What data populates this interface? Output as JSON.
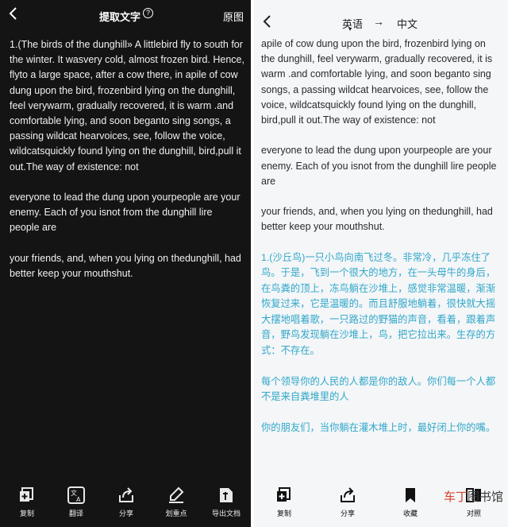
{
  "left": {
    "title": "提取文字",
    "help_icon": "?",
    "original_button": "原图",
    "paragraphs": [
      "1.(The birds of the dunghill» A littlebird fly to south for the winter. It wasvery cold, almost frozen bird. Hence, flyto a large space, after a cow there, in apile of cow dung upon the bird, frozenbird lying on the dunghill, feel verywarm, gradually recovered, it is warm .and comfortable lying, and soon beganto sing songs, a passing wildcat hearvoices, see, follow the voice, wildcatsquickly found lying on the dunghill, bird,pull it out.The way of existence: not",
      "everyone to lead the dung upon yourpeople are your enemy. Each of you isnot from the dunghill lire people are",
      "your friends, and, when you lying on thedunghill, had better keep your mouthshut."
    ],
    "toolbar": [
      {
        "label": "复制",
        "icon": "copy-icon"
      },
      {
        "label": "翻译",
        "icon": "translate-icon"
      },
      {
        "label": "分享",
        "icon": "share-icon"
      },
      {
        "label": "划重点",
        "icon": "highlight-icon"
      },
      {
        "label": "导出文档",
        "icon": "export-document-icon"
      }
    ]
  },
  "right": {
    "source_lang": "英语",
    "arrow": "→",
    "target_lang": "中文",
    "caret": "▾",
    "english_paragraphs": [
      "apile of cow dung upon the bird, frozenbird lying on the dunghill, feel verywarm, gradually recovered, it is warm .and comfortable lying, and soon beganto sing songs, a passing wildcat hearvoices, see, follow the voice, wildcatsquickly found lying on the dunghill, bird,pull it out.The way of existence: not",
      "everyone to lead the dung upon yourpeople are your enemy. Each of you isnot from the dunghill lire people are",
      "your friends, and, when you lying on thedunghill, had better keep your mouthshut."
    ],
    "chinese_paragraphs": [
      "1.(沙丘鸟)一只小鸟向南飞过冬。非常冷，几乎冻住了鸟。于是，飞到一个很大的地方，在一头母牛的身后，在鸟粪的顶上，冻鸟躺在沙堆上，感觉非常温暖，渐渐恢复过来，它是温暖的。而且舒服地躺着，很快就大摇大摆地唱着歌，一只路过的野猫的声音，看着，跟着声音，野鸟发现躺在沙堆上，鸟，把它拉出来。生存的方式：不存在。",
      "每个领导你的人民的人都是你的敌人。你们每一个人都不是来自粪堆里的人",
      "你的朋友们，当你躺在灌木堆上时，最好闭上你的嘴。"
    ],
    "toolbar": [
      {
        "label": "复制",
        "icon": "copy-icon"
      },
      {
        "label": "分享",
        "icon": "share-icon"
      },
      {
        "label": "收藏",
        "icon": "bookmark-icon"
      },
      {
        "label": "对照",
        "icon": "compare-icon"
      }
    ],
    "watermark": {
      "brand": "车丁",
      "rest": "图书馆"
    }
  }
}
